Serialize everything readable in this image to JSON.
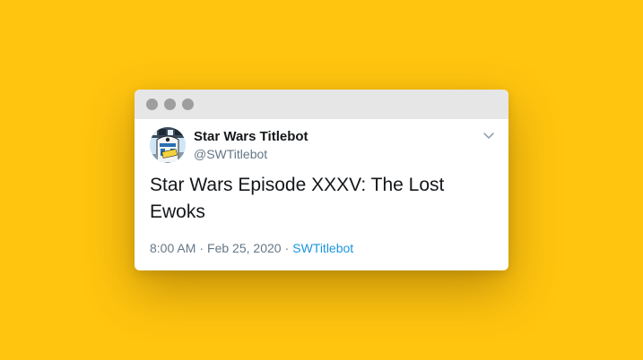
{
  "window": {
    "controls": [
      "close",
      "minimize",
      "zoom"
    ]
  },
  "tweet": {
    "display_name": "Star Wars Titlebot",
    "handle": "@SWTitlebot",
    "text": "Star Wars Episode XXXV: The Lost Ewoks",
    "time": "8:00 AM",
    "separator": "·",
    "date": "Feb 25, 2020",
    "source": "SWTitlebot",
    "avatar_icon": "robot-avatar",
    "menu_icon": "chevron-down-icon"
  },
  "colors": {
    "background": "#FFC50F",
    "titlebar": "#E6E6E6",
    "window_dots": "#9E9E9E",
    "text_primary": "#14171A",
    "text_secondary": "#657786",
    "link": "#1B95E0"
  }
}
